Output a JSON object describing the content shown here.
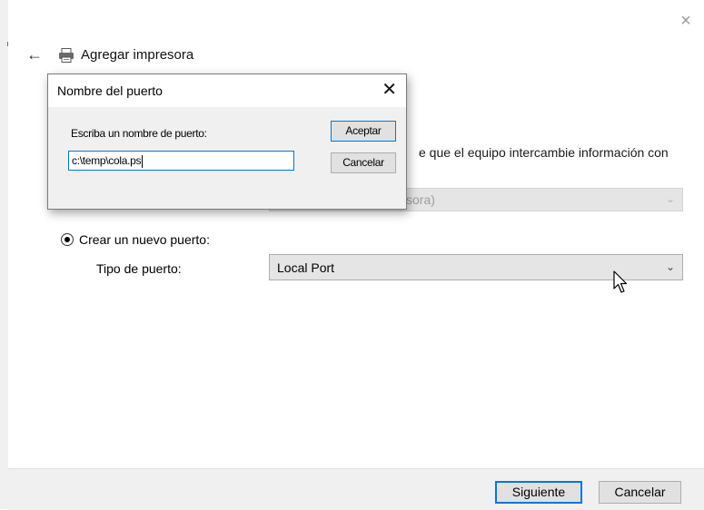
{
  "wizard": {
    "title": "Agregar impresora",
    "description_partial": "e que el equipo intercambie información con",
    "existing_port_value_partial": "sora)",
    "create_new_port_label": "Crear un nuevo puerto:",
    "port_type_label": "Tipo de puerto:",
    "port_type_value": "Local Port",
    "next_button": "Siguiente",
    "cancel_button": "Cancelar",
    "close_glyph": "×",
    "back_glyph": "←"
  },
  "port_dialog": {
    "title": "Nombre del puerto",
    "prompt": "Escriba un nombre de puerto:",
    "input_value": "c:\\temp\\cola.ps",
    "ok_button": "Aceptar",
    "cancel_button": "Cancelar",
    "close_glyph": "✕"
  },
  "icons": {
    "back": "back-arrow-icon",
    "printer": "printer-icon",
    "chevron": "chevron-down-icon",
    "pointer": "mouse-pointer-icon"
  },
  "colors": {
    "accent": "#0078d7",
    "dialog_bg": "#f0f0f0",
    "select_bg": "#e5e5e5",
    "footer_bg": "#f0f0f0"
  }
}
